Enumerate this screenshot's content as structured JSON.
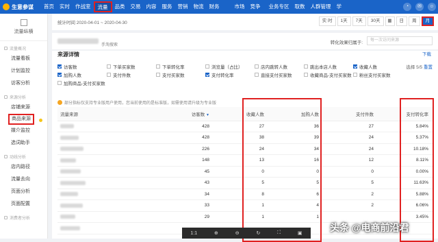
{
  "topnav": {
    "brand": "生意参谋",
    "items": [
      "首页",
      "实时",
      "作战室",
      "流量",
      "品类",
      "交易",
      "内容",
      "服务",
      "营销",
      "物流",
      "财务",
      "市场",
      "竞争",
      "业务专区",
      "取数",
      "人群管理",
      "学"
    ],
    "active_index": 3
  },
  "sidebar": {
    "title": "流量纵横",
    "sections": [
      {
        "label": "流量概况",
        "items": [
          "流量看板",
          "计划监控",
          "访客分析"
        ]
      },
      {
        "label": "来源分析",
        "items": [
          "店铺来源",
          "商品来源",
          "媒介监控",
          "选词助手"
        ]
      },
      {
        "label": "动线分析",
        "items": [
          "店内路径",
          "流量去向",
          "页面分析",
          "页面配置"
        ]
      },
      {
        "label": "消费者分析",
        "items": []
      }
    ],
    "highlighted": "商品来源"
  },
  "datebar": {
    "range": "统计时间 2020-04-01 ~ 2020-04-30",
    "periods": [
      "实 时",
      "1天",
      "7天",
      "30天",
      "日",
      "周",
      "月"
    ],
    "selected": "月"
  },
  "shopbar": {
    "tag": "手淘搜索",
    "compare_label": "转化效果归属于:",
    "compare_placeholder": "每一次访问来源"
  },
  "panel": {
    "title": "来源详情",
    "download": "下载",
    "select_count_prefix": "选择 ",
    "select_count": "5/5",
    "reset": "重置",
    "notice": "部分指标仅支持专业版用户使用，您当前使用的是标准版，如需使用请升级为专业版"
  },
  "metrics": [
    {
      "label": "访客数",
      "checked": true
    },
    {
      "label": "下单买家数",
      "checked": false
    },
    {
      "label": "下单转化率",
      "checked": false
    },
    {
      "label": "浏览量（占比）",
      "checked": false
    },
    {
      "label": "店内跳转人数",
      "checked": false
    },
    {
      "label": "跳出本店人数",
      "checked": false
    },
    {
      "label": "收藏人数",
      "checked": true
    },
    {
      "label": "加购人数",
      "checked": true
    },
    {
      "label": "支付件数",
      "checked": false
    },
    {
      "label": "支付买家数",
      "checked": false
    },
    {
      "label": "支付转化率",
      "checked": true
    },
    {
      "label": "直接支付买家数",
      "checked": false
    },
    {
      "label": "收藏商品-支付买家数",
      "checked": false
    },
    {
      "label": "粉丝支付买家数",
      "checked": false
    },
    {
      "label": "加购商品-支付买家数",
      "checked": false
    }
  ],
  "table": {
    "headers": [
      "流量来源",
      "访客数",
      "收藏人数",
      "加购人数",
      "支付件数",
      "支付转化率"
    ],
    "rows": [
      [
        "",
        "428",
        "27",
        "36",
        "27",
        "5.84%"
      ],
      [
        "",
        "428",
        "38",
        "39",
        "24",
        "5.37%"
      ],
      [
        "",
        "226",
        "24",
        "34",
        "24",
        "10.18%"
      ],
      [
        "",
        "148",
        "13",
        "16",
        "12",
        "8.11%"
      ],
      [
        "",
        "45",
        "0",
        "0",
        "0",
        "0.00%"
      ],
      [
        "",
        "43",
        "5",
        "5",
        "5",
        "11.63%"
      ],
      [
        "",
        "34",
        "8",
        "6",
        "2",
        "5.88%"
      ],
      [
        "",
        "33",
        "1",
        "4",
        "2",
        "6.06%"
      ],
      [
        "",
        "29",
        "1",
        "1",
        "",
        "3.45%"
      ],
      [
        "",
        "",
        "",
        "",
        "",
        ""
      ]
    ]
  },
  "watermark": "头条 @电商前沿君",
  "colors": {
    "brand": "#1a64c8",
    "highlight": "#e02020"
  }
}
